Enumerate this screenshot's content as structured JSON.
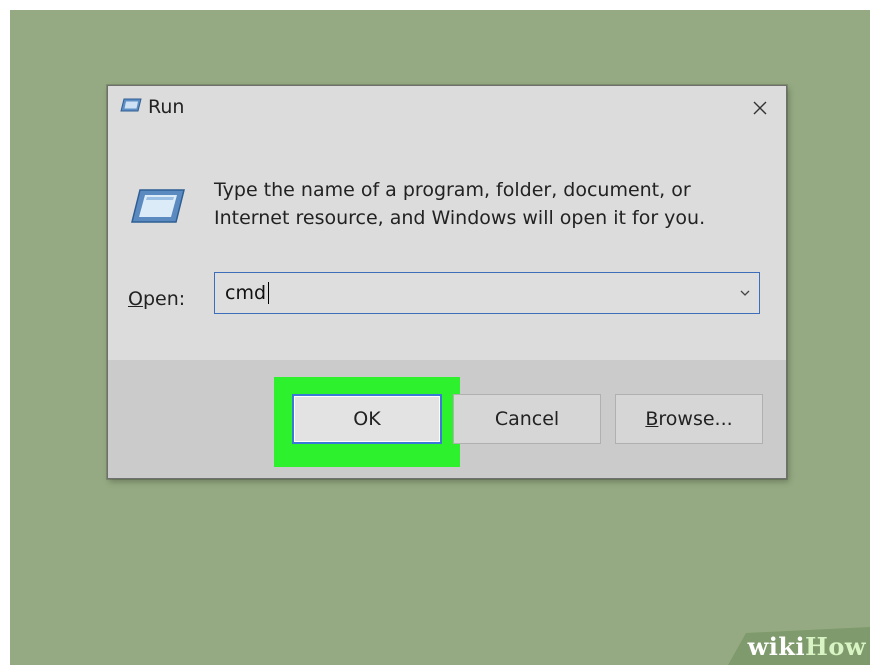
{
  "dialog": {
    "title": "Run",
    "description": "Type the name of a program, folder, document, or Internet resource, and Windows will open it for you.",
    "open_label_accel": "O",
    "open_label_rest": "pen:",
    "input_value": "cmd",
    "buttons": {
      "ok": "OK",
      "cancel": "Cancel",
      "browse_accel": "B",
      "browse_rest": "rowse..."
    }
  },
  "watermark": {
    "part1": "wiki",
    "part2": "How"
  },
  "colors": {
    "background": "#95aa82",
    "highlight": "#2cf12c",
    "focus_border": "#3c78d8"
  }
}
